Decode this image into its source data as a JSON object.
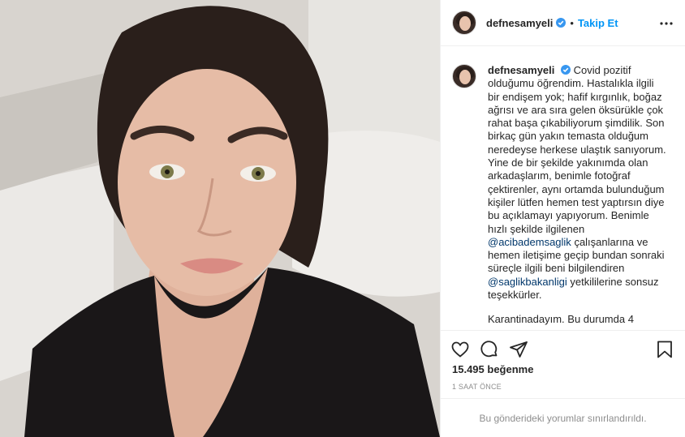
{
  "post": {
    "username": "defnesamyeli",
    "dot": "•",
    "follow_label": "Takip Et",
    "caption": {
      "p1_a": "Covid pozitif olduğumu öğrendim. Hastalıkla ilgili bir endişem yok; hafif kırgınlık, boğaz ağrısı ve ara sıra gelen öksürükle çok rahat başa çıkabiliyorum şimdilik. Son birkaç gün yakın temasta olduğum neredeyse herkese ulaştık sanıyorum. Yine de bir şekilde yakınımda olan arkadaşlarım, benimle fotoğraf çektirenler, aynı ortamda bulunduğum kişiler lütfen hemen test yaptırsın diye bu açıklamayı yapıyorum. Benimle hızlı şekilde ilgilenen",
      "mention1": "@acibademsaglik",
      "p1_b": "çalışanlarına ve hemen iletişime geçip bundan sonraki süreçle ilgili beni bilgilendiren",
      "mention2": "@saglikbakanligi",
      "p1_c": "yetkililerine sonsuz teşekkürler.",
      "p2": "Karantinadayım. Bu durumda 4"
    },
    "likes": "15.495 beğenme",
    "time_ago": "1 SAAT ÖNCE",
    "comments_notice": "Bu gönderideki yorumlar sınırlandırıldı."
  },
  "icons": {
    "verified": "verified-badge-icon",
    "more": "more-options-icon",
    "like": "heart-icon",
    "comment": "comment-icon",
    "share": "share-icon",
    "save": "bookmark-icon"
  },
  "colors": {
    "link": "#0095f6",
    "mention": "#00376b",
    "muted": "#8e8e8e",
    "border": "#efefef"
  }
}
